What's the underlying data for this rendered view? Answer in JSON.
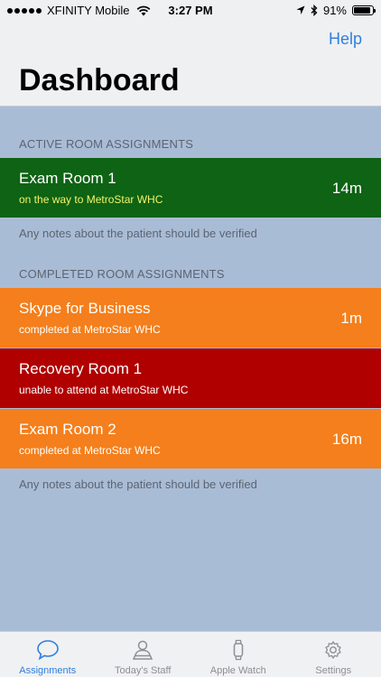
{
  "status_bar": {
    "carrier": "XFINITY Mobile",
    "time": "3:27 PM",
    "battery": "91%",
    "battery_level": 0.91
  },
  "nav": {
    "help_label": "Help",
    "title": "Dashboard"
  },
  "active": {
    "header": "ACTIVE ROOM ASSIGNMENTS",
    "items": [
      {
        "room": "Exam Room 1",
        "status": "on the way to MetroStar WHC",
        "time": "14m",
        "color": "#0e6314"
      }
    ],
    "note": "Any notes about the patient should be verified"
  },
  "completed": {
    "header": "COMPLETED ROOM ASSIGNMENTS",
    "items": [
      {
        "room": "Skype for Business",
        "status": "completed at MetroStar WHC",
        "time": "1m",
        "color": "#f47f1c"
      },
      {
        "room": "Recovery Room 1",
        "status": "unable to attend at MetroStar WHC",
        "time": "",
        "color": "#b00000"
      },
      {
        "room": "Exam Room 2",
        "status": "completed at MetroStar WHC",
        "time": "16m",
        "color": "#f47f1c"
      }
    ],
    "note": "Any notes about the patient should be verified"
  },
  "tabs": [
    {
      "label": "Assignments",
      "icon": "chat-bubble-icon",
      "active": true
    },
    {
      "label": "Today's Staff",
      "icon": "staff-icon",
      "active": false
    },
    {
      "label": "Apple Watch",
      "icon": "watch-icon",
      "active": false
    },
    {
      "label": "Settings",
      "icon": "gear-icon",
      "active": false
    }
  ],
  "colors": {
    "accent": "#2f7fe0",
    "background": "#a9bcd6"
  }
}
